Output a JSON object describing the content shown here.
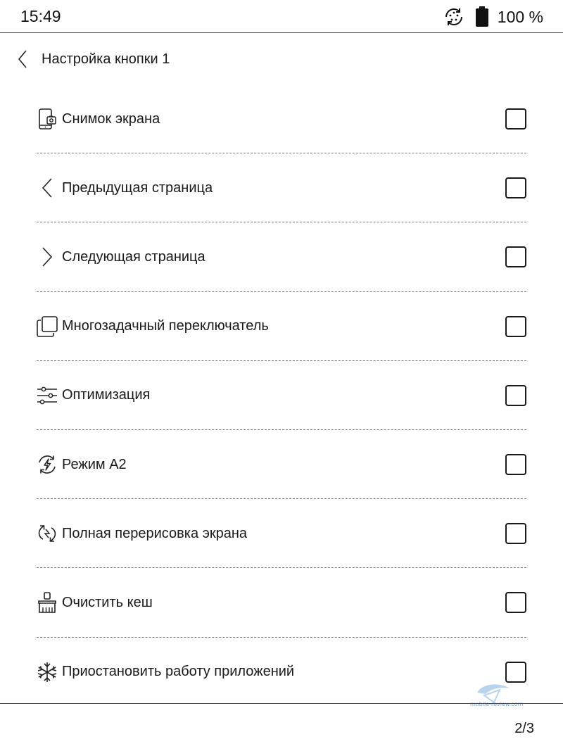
{
  "status_bar": {
    "time": "15:49",
    "battery": "100 %",
    "icons": [
      "sync-icon",
      "battery-icon"
    ]
  },
  "header": {
    "back_icon": "chevron-left-icon",
    "title": "Настройка кнопки 1"
  },
  "items": [
    {
      "label": "Снимок экрана",
      "icon": "screenshot-icon",
      "checked": false
    },
    {
      "label": "Предыдущая страница",
      "icon": "chevron-left-icon",
      "checked": false
    },
    {
      "label": "Следующая страница",
      "icon": "chevron-right-icon",
      "checked": false
    },
    {
      "label": "Многозадачный переключатель",
      "icon": "multitask-icon",
      "checked": false
    },
    {
      "label": "Оптимизация",
      "icon": "sliders-icon",
      "checked": false
    },
    {
      "label": "Режим A2",
      "icon": "a2-mode-icon",
      "checked": false
    },
    {
      "label": "Полная перерисовка экрана",
      "icon": "refresh-icon",
      "checked": false
    },
    {
      "label": "Очистить кеш",
      "icon": "broom-icon",
      "checked": false
    },
    {
      "label": "Приостановить работу приложений",
      "icon": "snowflake-icon",
      "checked": false
    }
  ],
  "pagination": {
    "label": "2/3"
  },
  "watermark": {
    "text": "mobile-review.com"
  }
}
